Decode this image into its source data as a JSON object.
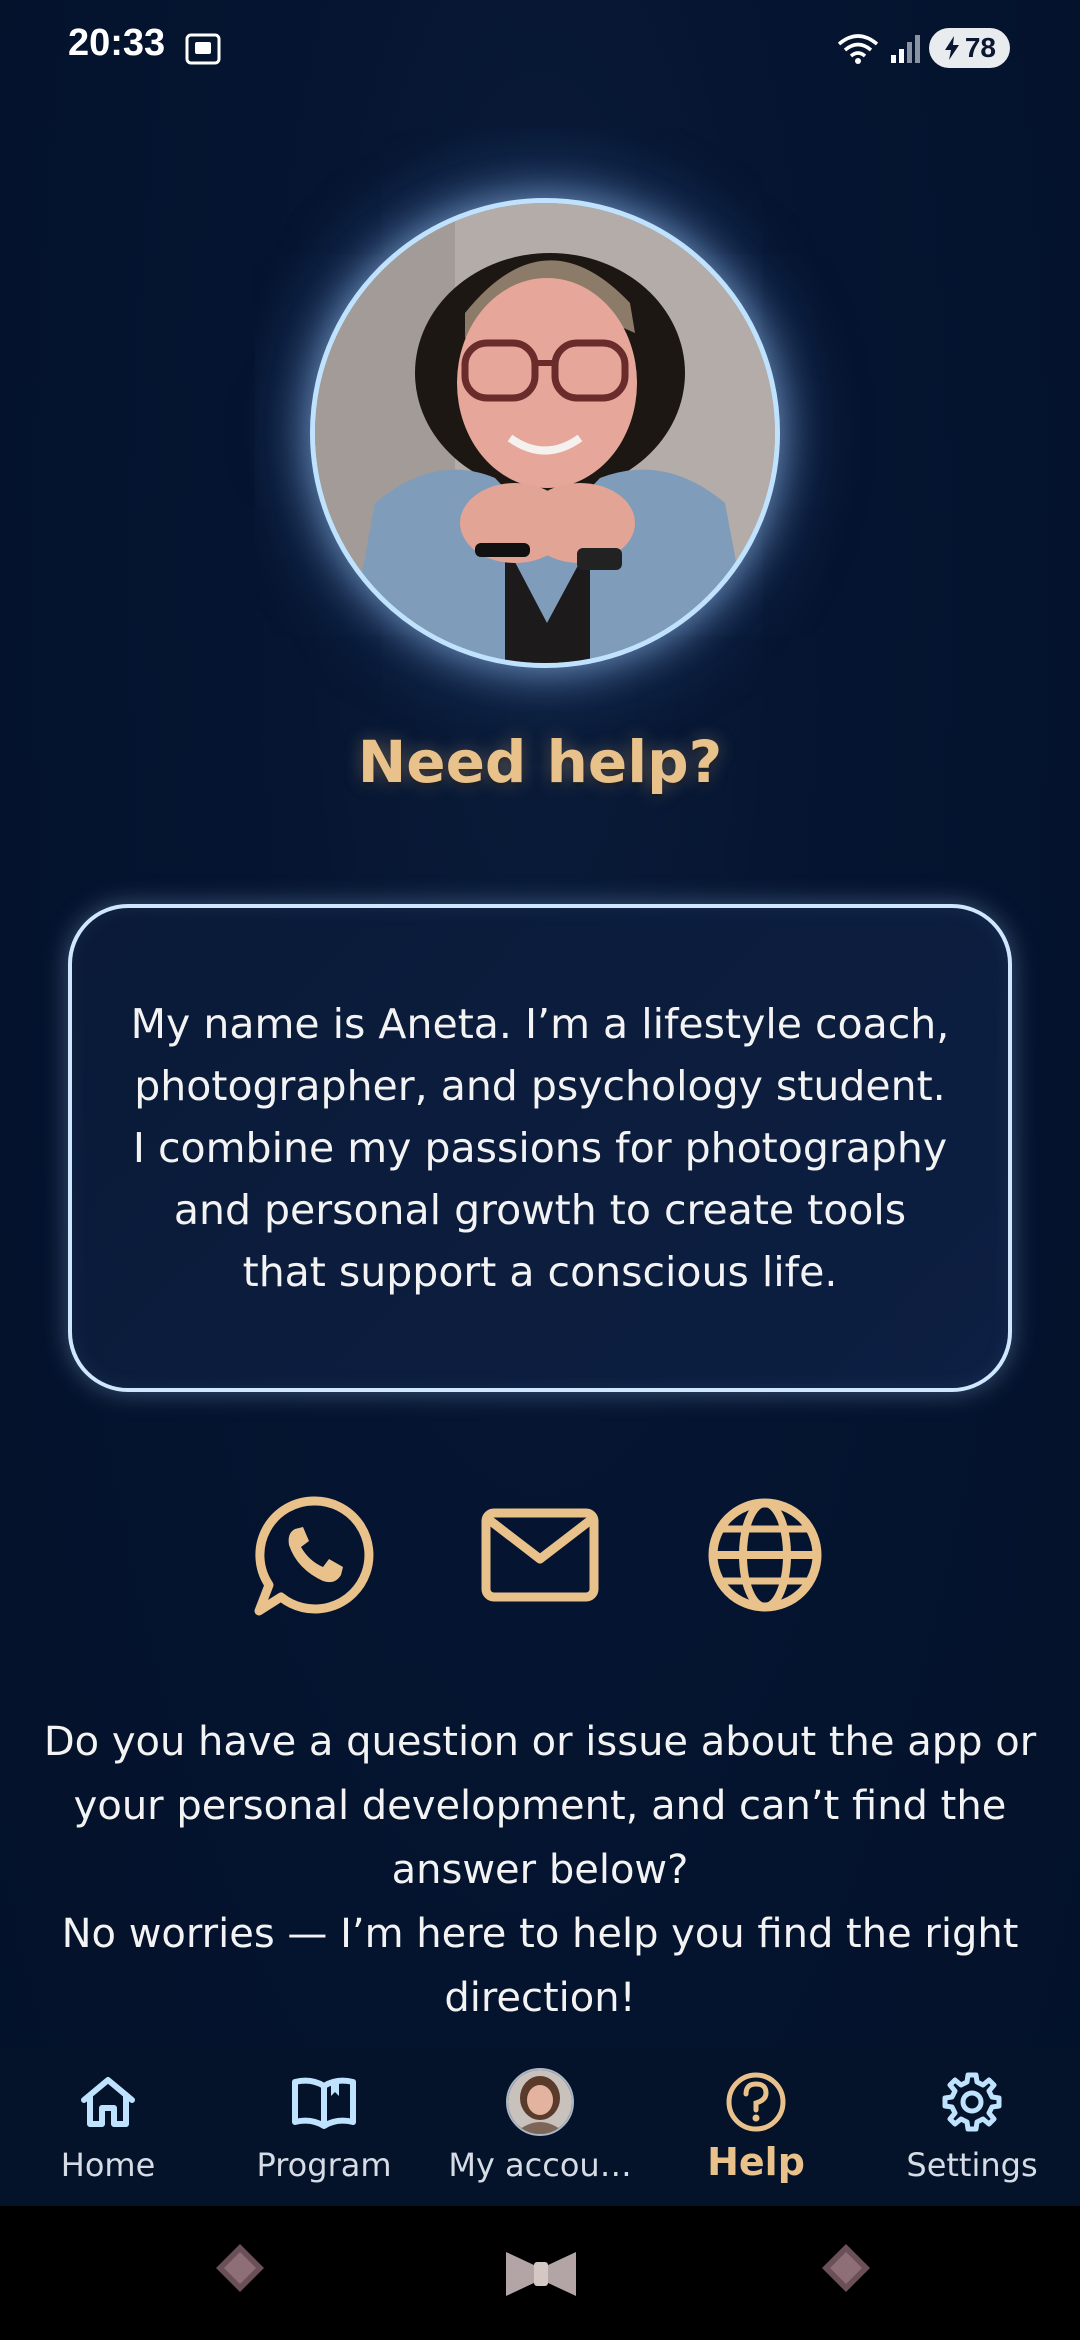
{
  "status_bar": {
    "time": "20:33",
    "battery": "78",
    "icons": [
      "screenshot-icon",
      "wifi-icon",
      "signal-icon",
      "battery-charging-icon"
    ]
  },
  "profile": {
    "photo_icon": "portrait-photo"
  },
  "heading": "Need help?",
  "bio": "My name is Aneta. I’m a lifestyle coach, photographer, and psychology student. I combine my passions for photography and personal growth to create tools that support a conscious life.",
  "contacts": [
    {
      "icon": "whatsapp-icon"
    },
    {
      "icon": "mail-icon"
    },
    {
      "icon": "globe-icon"
    }
  ],
  "help_text": {
    "line1": "Do you have a question or issue about the app or your personal development, and can’t find the answer below?",
    "line2": "No worries — I’m here to help you find the right direction!"
  },
  "nav": {
    "items": [
      {
        "label": "Home",
        "icon": "home-icon"
      },
      {
        "label": "Program",
        "icon": "book-icon"
      },
      {
        "label": "My accou…",
        "icon": "avatar-icon"
      },
      {
        "label": "Help",
        "icon": "help-icon",
        "active": true
      },
      {
        "label": "Settings",
        "icon": "gear-icon"
      }
    ]
  },
  "colors": {
    "background": "#04122a",
    "accent_gold": "#e9c18b",
    "card_border": "#cfe8ff",
    "nav_icon": "#bfe3ff"
  }
}
